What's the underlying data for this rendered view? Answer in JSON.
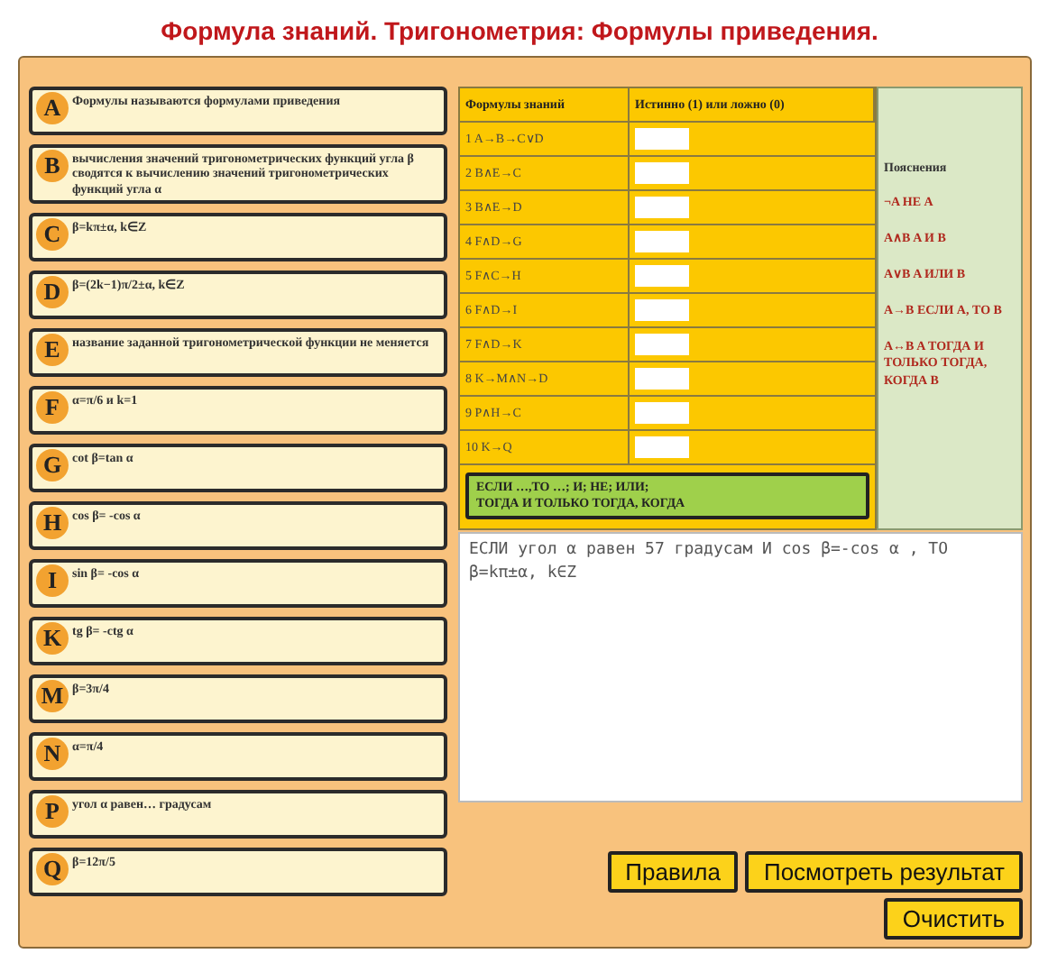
{
  "title": "Формула знаний. Тригонометрия: Формулы приведения.",
  "facts": [
    {
      "letter": "A",
      "text": "Формулы называются формулами приведения"
    },
    {
      "letter": "B",
      "text": "вычисления значений тригонометрических функций угла β сводятся к вычислению значений тригонометрических функций угла α"
    },
    {
      "letter": "C",
      "text": "β=kπ±α, k∈Z"
    },
    {
      "letter": "D",
      "text": "β=(2k−1)π/2±α, k∈Z"
    },
    {
      "letter": "E",
      "text": "название заданной тригонометрической функции не меняется"
    },
    {
      "letter": "F",
      "text": "α=π/6 и k=1"
    },
    {
      "letter": "G",
      "text": "cot β=tan α"
    },
    {
      "letter": "H",
      "text": "cos β= -cos α"
    },
    {
      "letter": "I",
      "text": "sin β= -cos α"
    },
    {
      "letter": "K",
      "text": "tg β= -ctg α"
    },
    {
      "letter": "M",
      "text": "β=3π/4"
    },
    {
      "letter": "N",
      "text": "α=π/4"
    },
    {
      "letter": "P",
      "text": "угол α равен… градусам"
    },
    {
      "letter": "Q",
      "text": "β=12π/5"
    }
  ],
  "table": {
    "columns": [
      "Формулы знаний",
      "Истинно (1) или ложно (0)"
    ],
    "rows": [
      {
        "formula": "1 A→B→C∨D"
      },
      {
        "formula": "2 B∧E→C"
      },
      {
        "formula": "3 B∧E→D"
      },
      {
        "formula": "4 F∧D→G"
      },
      {
        "formula": "5 F∧C→H"
      },
      {
        "formula": "6 F∧D→I"
      },
      {
        "formula": "7 F∧D→K"
      },
      {
        "formula": "8 K→M∧N→D"
      },
      {
        "formula": "9 P∧H→C"
      },
      {
        "formula": "10 K→Q"
      }
    ]
  },
  "connectives": [
    "ЕСЛИ …,ТО …; И; НЕ; ИЛИ;",
    "ТОГДА И ТОЛЬКО ТОГДА, КОГДА"
  ],
  "explanations": {
    "title": "Пояснения",
    "items": [
      "¬A НЕ A",
      "A∧B A И B",
      "A∨B A ИЛИ B",
      "A→B ЕСЛИ A, ТО B",
      "A↔B A ТОГДА И ТОЛЬКО ТОГДА, КОГДА B"
    ]
  },
  "answer": "ЕСЛИ угол α равен 57 градусам И cos β=-cos α , ТО β=kπ±α, k∈Z",
  "buttons": {
    "rules": "Правила",
    "result": "Посмотреть результат",
    "clear": "Очистить"
  }
}
